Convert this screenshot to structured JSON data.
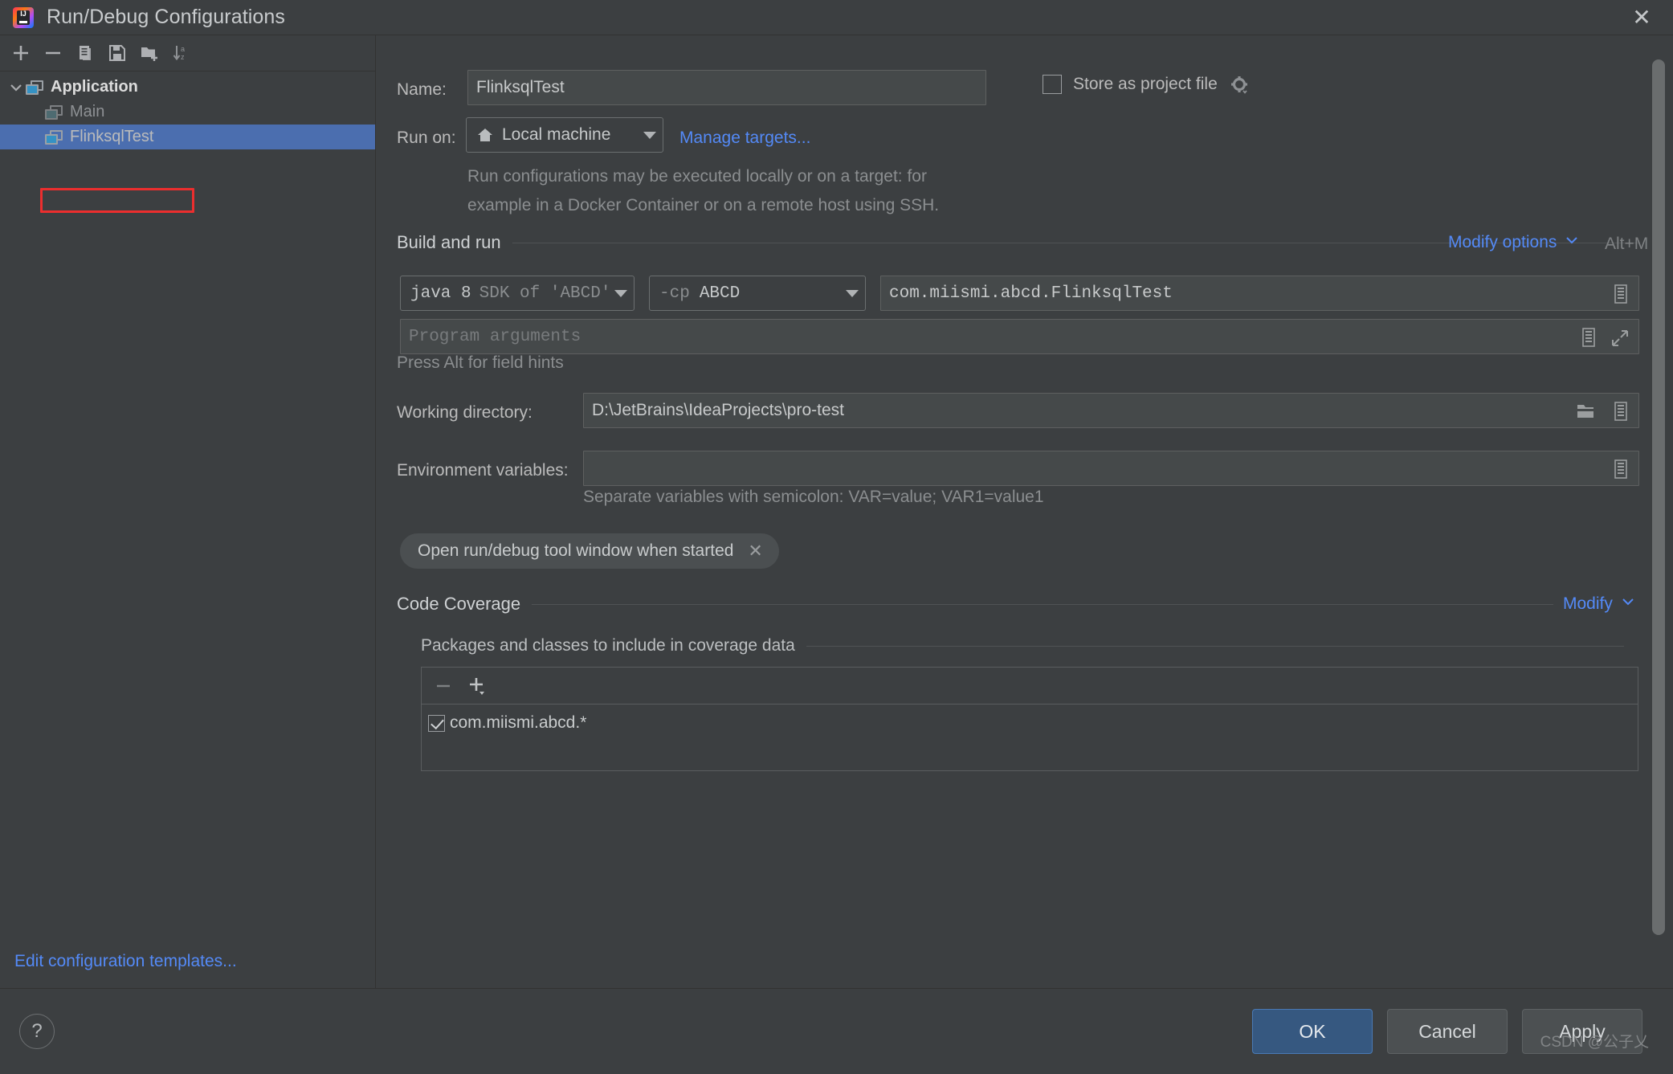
{
  "window": {
    "title": "Run/Debug Configurations",
    "logo_text": "IJ",
    "close_icon": "close-icon"
  },
  "left_panel": {
    "toolbar": [
      {
        "name": "add-configuration-button",
        "icon": "plus-icon",
        "glyph": "+"
      },
      {
        "name": "remove-configuration-button",
        "icon": "minus-icon",
        "glyph": "−"
      },
      {
        "name": "copy-configuration-button",
        "icon": "copy-icon",
        "glyph": ""
      },
      {
        "name": "save-configuration-button",
        "icon": "save-icon",
        "glyph": ""
      },
      {
        "name": "move-into-folder-button",
        "icon": "new-folder-icon",
        "glyph": ""
      },
      {
        "name": "sort-configurations-button",
        "icon": "sort-alphabetically-icon",
        "glyph": ""
      }
    ],
    "tree": [
      {
        "label": "Application",
        "level": 0,
        "expanded": true,
        "selected": false,
        "dim": false
      },
      {
        "label": "Main",
        "level": 1,
        "expanded": false,
        "selected": false,
        "dim": true
      },
      {
        "label": "FlinksqlTest",
        "level": 1,
        "expanded": false,
        "selected": true,
        "dim": false,
        "highlighted": true
      }
    ],
    "edit_templates_link": "Edit configuration templates..."
  },
  "form": {
    "name_label": "Name:",
    "name_value": "FlinksqlTest",
    "store_as_project_file_label": "Store as project file",
    "store_as_project_file_checked": false,
    "store_gear_icon": "gear-icon",
    "run_on_label": "Run on:",
    "run_on_value": "Local machine",
    "run_on_icon": "home-icon",
    "manage_targets_link": "Manage targets...",
    "run_on_description_line1": "Run configurations may be executed locally or on a target: for",
    "run_on_description_line2": "example in a Docker Container or on a remote host using SSH.",
    "build_and_run_title": "Build and run",
    "modify_options_link": "Modify options",
    "modify_options_shortcut": "Alt+M",
    "jre_value_main": "java 8",
    "jre_value_secondary": "SDK of 'ABCD'",
    "classpath_prefix": "-cp",
    "classpath_value": "ABCD",
    "main_class_value": "com.miismi.abcd.FlinksqlTest",
    "main_class_expand_icon": "expand-list-icon",
    "program_arguments_placeholder": "Program arguments",
    "program_arguments_value": "",
    "program_args_macro_icon": "macro-icon",
    "program_args_expand_icon": "expand-editor-icon",
    "field_hints_text": "Press Alt for field hints",
    "working_directory_label": "Working directory:",
    "working_directory_value": "D:\\JetBrains\\IdeaProjects\\pro-test",
    "working_dir_browse_icon": "folder-icon",
    "working_dir_macro_icon": "macro-icon",
    "environment_variables_label": "Environment variables:",
    "environment_variables_value": "",
    "environment_variables_icon": "browse-icon",
    "environment_variables_hint": "Separate variables with semicolon: VAR=value; VAR1=value1",
    "option_chip_label": "Open run/debug tool window when started",
    "option_chip_remove_icon": "close-icon"
  },
  "code_coverage": {
    "title": "Code Coverage",
    "modify_link": "Modify",
    "subtitle": "Packages and classes to include in coverage data",
    "toolbar": [
      {
        "name": "remove-package-button",
        "icon": "minus-icon",
        "glyph": "−"
      },
      {
        "name": "add-package-button",
        "icon": "plus-icon",
        "glyph": "+"
      }
    ],
    "rows": [
      {
        "label": "com.miismi.abcd.*",
        "checked": true
      }
    ]
  },
  "footer": {
    "help_label": "?",
    "ok_label": "OK",
    "cancel_label": "Cancel",
    "apply_label": "Apply",
    "watermark": "CSDN @公子乂"
  },
  "colors": {
    "background": "#3c3f41",
    "selection_blue": "#4b6eaf",
    "link_blue": "#548af7",
    "primary_button": "#365880",
    "highlight_red": "#ec2e2e",
    "field_background": "#45494a",
    "icon_teal": "#3592c4"
  }
}
